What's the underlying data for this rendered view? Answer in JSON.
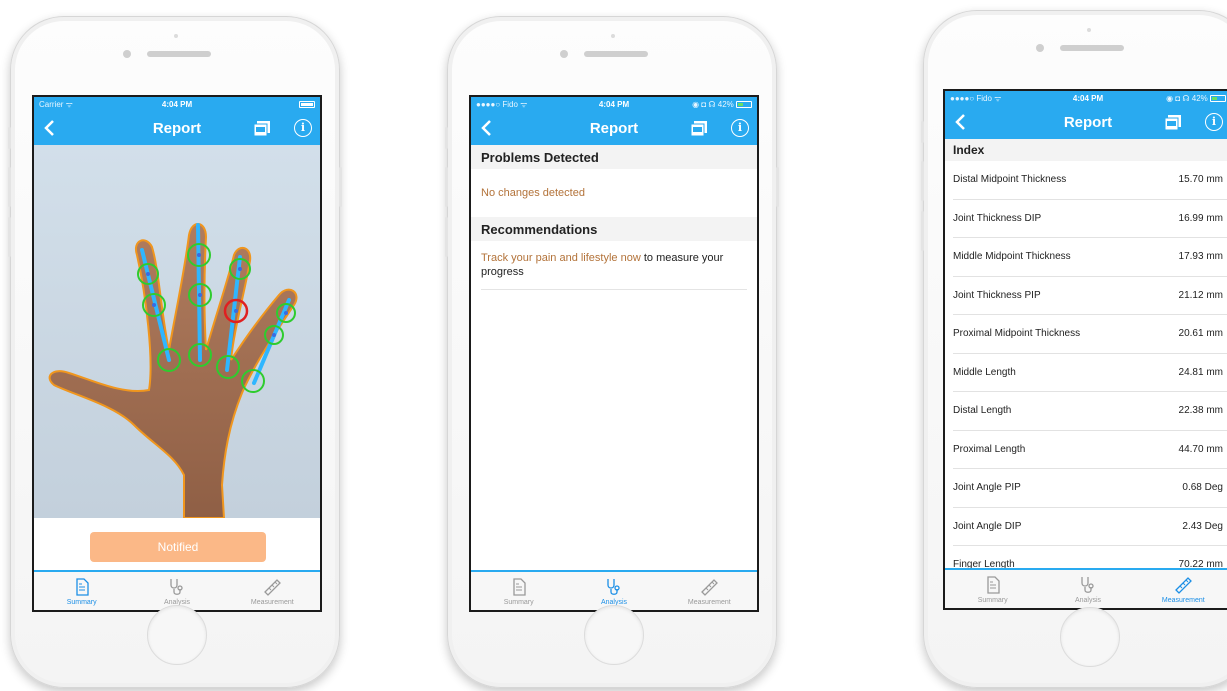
{
  "phones": [
    {
      "status": {
        "carrier": "Carrier ᯤ",
        "time": "4:04 PM",
        "battery_pct": ""
      },
      "title": "Report",
      "button_label": "Notified"
    },
    {
      "status": {
        "carrier": "●●●●○ Fido ᯤ",
        "time": "4:04 PM",
        "battery_pct": "◉ ◘ ☊ 42%"
      },
      "title": "Report",
      "problems_header": "Problems Detected",
      "problems_text": "No changes detected",
      "recommend_header": "Recommendations",
      "recommend_link": "Track your pain and lifestyle now",
      "recommend_text": " to measure your progress"
    },
    {
      "status": {
        "carrier": "●●●●○ Fido ᯤ",
        "time": "4:04 PM",
        "battery_pct": "◉ ◘ ☊ 42%"
      },
      "title": "Report",
      "index_header": "Index",
      "measurements": [
        {
          "label": "Distal Midpoint Thickness",
          "value": "15.70 mm"
        },
        {
          "label": "Joint Thickness DIP",
          "value": "16.99 mm"
        },
        {
          "label": "Middle Midpoint Thickness",
          "value": "17.93 mm"
        },
        {
          "label": "Joint Thickness PIP",
          "value": "21.12 mm"
        },
        {
          "label": "Proximal Midpoint Thickness",
          "value": "20.61 mm"
        },
        {
          "label": "Middle Length",
          "value": "24.81 mm"
        },
        {
          "label": "Distal Length",
          "value": "22.38 mm"
        },
        {
          "label": "Proximal Length",
          "value": "44.70 mm"
        },
        {
          "label": "Joint Angle PIP",
          "value": "0.68 Deg"
        },
        {
          "label": "Joint Angle DIP",
          "value": "2.43 Deg"
        },
        {
          "label": "Finger Length",
          "value": "70.22 mm"
        }
      ]
    }
  ],
  "tabs": [
    "Summary",
    "Analysis",
    "Measurement"
  ],
  "icons": {
    "back": "chevron-left-icon",
    "pdf": "pdf-icon",
    "info": "info-icon",
    "summary": "document-icon",
    "analysis": "stethoscope-icon",
    "measurement": "ruler-icon"
  },
  "colors": {
    "nav_bar": "#29aaf0",
    "active_tab": "#1c8fe6",
    "notified_button": "#fbb887",
    "link_text": "#b3733a",
    "joint_marker": "#2ecc2e",
    "flagged_joint": "#e02020"
  }
}
